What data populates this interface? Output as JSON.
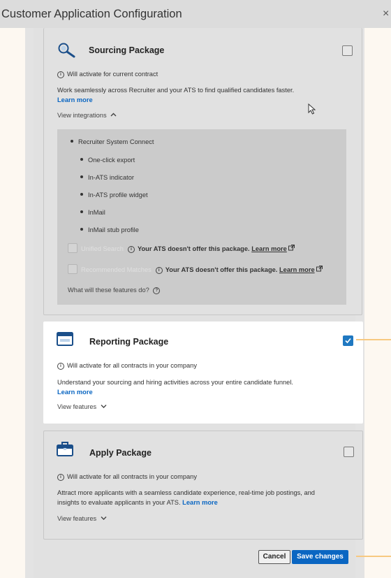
{
  "header": {
    "title": "Customer Application Configuration",
    "close_glyph": "×"
  },
  "sourcing": {
    "title": "Sourcing Package",
    "icon": "magnifier-icon",
    "checked": false,
    "activation": "Will activate for current contract",
    "description": "Work seamlessly across Recruiter and your ATS to find qualified candidates faster.",
    "learn_more": "Learn more",
    "toggle_label": "View integrations",
    "integrations": {
      "top_item": "Recruiter System Connect",
      "sub_items": [
        "One-click export",
        "In-ATS indicator",
        "In-ATS profile widget",
        "InMail",
        "InMail stub profile"
      ],
      "disabled_rows": [
        {
          "name": "Unified Search",
          "message": "Your ATS doesn't offer this package.",
          "link": "Learn more"
        },
        {
          "name": "Recommended Matches",
          "message": "Your ATS doesn't offer this package.",
          "link": "Learn more"
        }
      ],
      "footer_question": "What will these features do?"
    }
  },
  "reporting": {
    "title": "Reporting Package",
    "icon": "report-window-icon",
    "checked": true,
    "activation": "Will activate for all contracts in your company",
    "description": "Understand your sourcing and hiring activities across your entire candidate funnel.",
    "learn_more": "Learn more",
    "toggle_label": "View features"
  },
  "apply": {
    "title": "Apply Package",
    "icon": "briefcase-icon",
    "checked": false,
    "activation": "Will activate for all contracts in your company",
    "description_line1": "Attract more applicants with a seamless candidate experience, real-time job postings, and",
    "description_line2": "insights to evaluate applicants in your ATS.",
    "learn_more": "Learn more",
    "toggle_label": "View features"
  },
  "footer": {
    "cancel_label": "Cancel",
    "save_label": "Save changes"
  },
  "colors": {
    "accent": "#0a66c2",
    "pointer": "#f7c981",
    "checkbox_checked": "#1f78c1"
  }
}
